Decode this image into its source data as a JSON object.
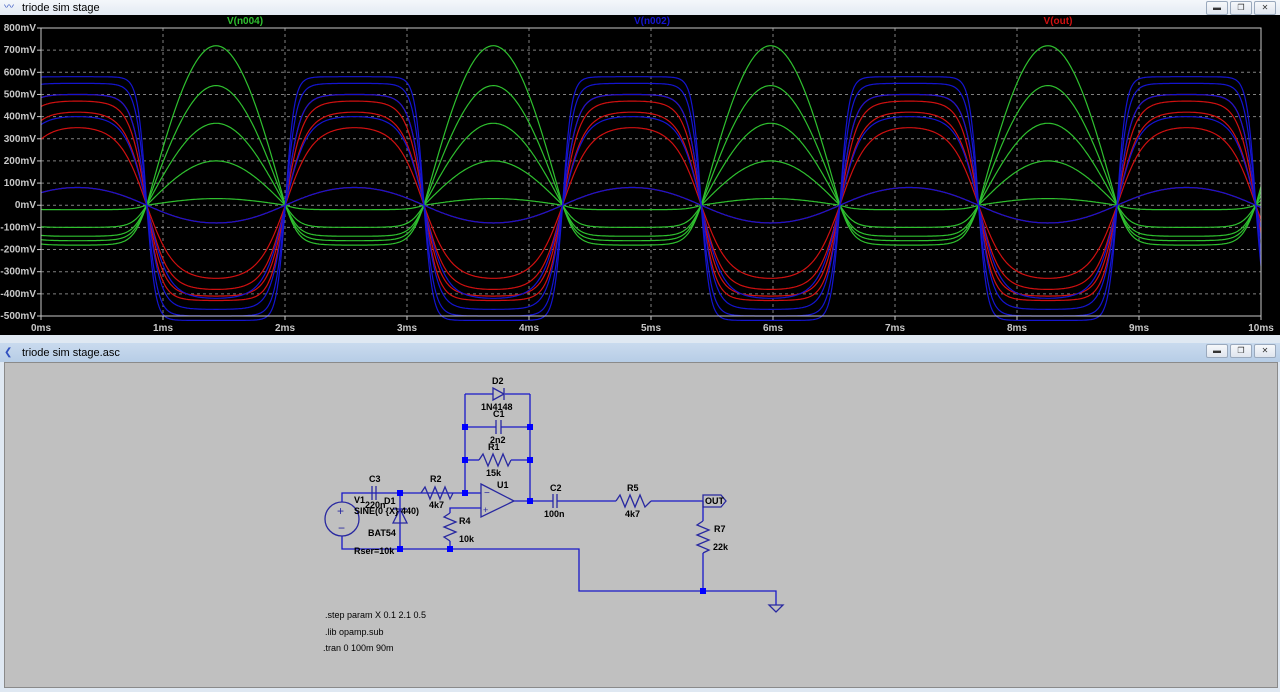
{
  "plot_window": {
    "title": "triode sim stage",
    "icon": "waveform-icon",
    "buttons": [
      "minimize",
      "restore",
      "close"
    ]
  },
  "schematic_window": {
    "title": "triode sim stage.asc",
    "icon": "ltspice-schematic-icon",
    "buttons": [
      "minimize",
      "restore",
      "close"
    ]
  },
  "chart_data": {
    "type": "line",
    "title": "",
    "xlabel": "",
    "ylabel": "",
    "xlim": [
      0,
      10
    ],
    "x_unit": "ms",
    "ylim": [
      -500,
      800
    ],
    "y_unit": "mV",
    "grid": true,
    "x_ticks": [
      "0ms",
      "1ms",
      "2ms",
      "3ms",
      "4ms",
      "5ms",
      "6ms",
      "7ms",
      "8ms",
      "9ms",
      "10ms"
    ],
    "y_ticks": [
      "800mV",
      "700mV",
      "600mV",
      "500mV",
      "400mV",
      "300mV",
      "200mV",
      "100mV",
      "0mV",
      "-100mV",
      "-200mV",
      "-300mV",
      "-400mV",
      "-500mV"
    ],
    "frequency_hz": 440,
    "step_param": "X",
    "step_values": [
      0.1,
      0.6,
      1.1,
      1.6,
      2.1
    ],
    "series": [
      {
        "name": "V(n004)",
        "color": "#2fc02f",
        "pos_peak_v": [
          0.03,
          0.2,
          0.37,
          0.54,
          0.72
        ],
        "neg_peak_v": [
          -0.02,
          -0.1,
          -0.14,
          -0.16,
          -0.18
        ]
      },
      {
        "name": "V(n002)",
        "color": "#1414d0",
        "pos_peak_v": [
          0.08,
          0.4,
          0.5,
          0.55,
          0.58
        ],
        "neg_peak_v": [
          -0.08,
          -0.42,
          -0.47,
          -0.5,
          -0.52
        ]
      },
      {
        "name": "V(out)",
        "color": "#d01010",
        "pos_peak_v": [
          0.08,
          0.35,
          0.42,
          0.47,
          0.5
        ],
        "neg_peak_v": [
          -0.08,
          -0.33,
          -0.38,
          -0.41,
          -0.43
        ]
      }
    ]
  },
  "schematic": {
    "V1": {
      "name": "V1",
      "value": "SINE(0 {X} 440)",
      "rser": "Rser=10k"
    },
    "C3": {
      "name": "C3",
      "value": "220n"
    },
    "D1": {
      "name": "D1",
      "value": "BAT54"
    },
    "R2": {
      "name": "R2",
      "value": "4k7"
    },
    "D2": {
      "name": "D2",
      "value": "1N4148"
    },
    "C1": {
      "name": "C1",
      "value": "2n2"
    },
    "R1": {
      "name": "R1",
      "value": "15k"
    },
    "U1": {
      "name": "U1"
    },
    "R4": {
      "name": "R4",
      "value": "10k"
    },
    "C2": {
      "name": "C2",
      "value": "100n"
    },
    "R5": {
      "name": "R5",
      "value": "4k7"
    },
    "R7": {
      "name": "R7",
      "value": "22k"
    },
    "out_label": "OUT",
    "directives": [
      ".step param X 0.1 2.1 0.5",
      ".lib opamp.sub",
      ".tran 0 100m 90m"
    ]
  }
}
